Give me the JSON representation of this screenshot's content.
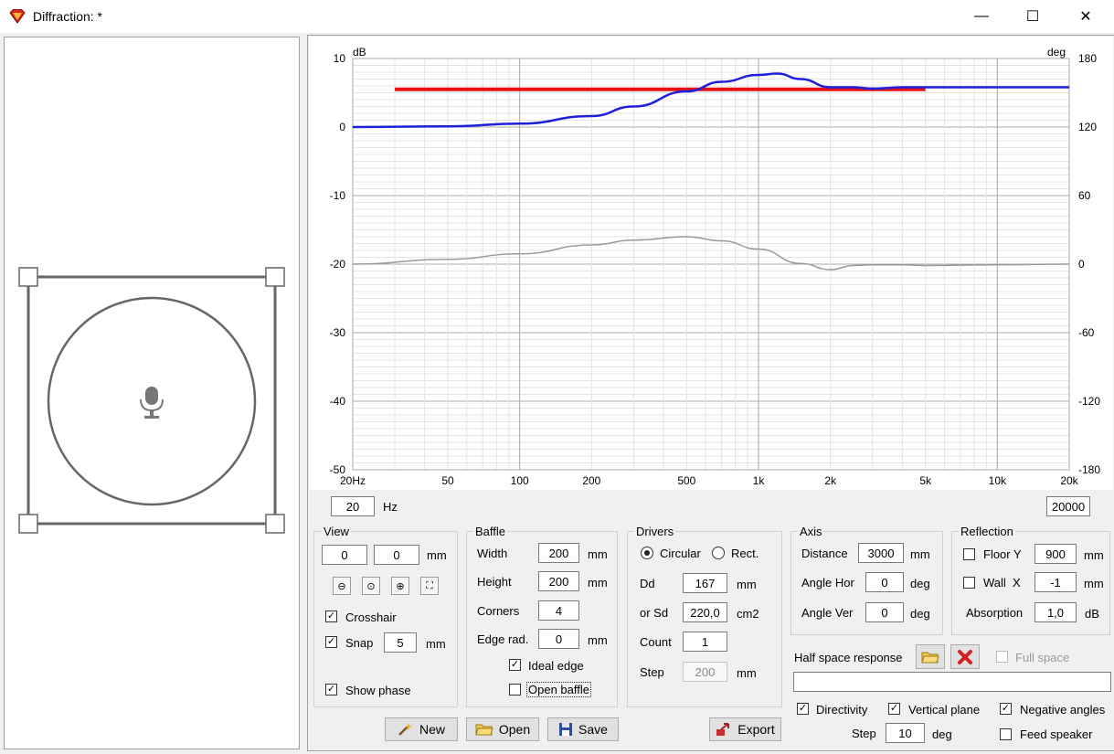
{
  "window": {
    "title": "Diffraction: *",
    "minimize": "—",
    "maximize": "☐",
    "close": "✕"
  },
  "plot": {
    "ylabel_left": "dB",
    "ylabel_right": "deg",
    "y_left_ticks": [
      "10",
      "0",
      "-10",
      "-20",
      "-30",
      "-40",
      "-50"
    ],
    "y_right_ticks": [
      "180",
      "120",
      "60",
      "0",
      "-60",
      "-120",
      "-180"
    ],
    "x_ticks": [
      "20Hz",
      "50",
      "100",
      "200",
      "500",
      "1k",
      "2k",
      "5k",
      "10k",
      "20k"
    ],
    "freq_min": "20",
    "freq_unit": "Hz",
    "freq_max": "20000"
  },
  "chart_data": {
    "type": "line",
    "x_scale": "log",
    "xlim": [
      20,
      20000
    ],
    "ylim": [
      -50,
      10
    ],
    "y2lim": [
      -180,
      180
    ],
    "xlabel": "",
    "ylabel": "dB",
    "y2label": "deg",
    "grid": true,
    "series": [
      {
        "color": "#1f1fdc",
        "axis": "left",
        "x": [
          20,
          50,
          100,
          200,
          300,
          500,
          700,
          1000,
          1200,
          1500,
          2000,
          2500,
          3000,
          4000,
          5000,
          7000,
          10000,
          20000
        ],
        "y": [
          0,
          0.1,
          0.5,
          1.6,
          3.0,
          5.2,
          6.6,
          7.6,
          7.8,
          7.0,
          5.8,
          5.8,
          5.6,
          5.8,
          5.8,
          5.8,
          5.8,
          5.8
        ]
      },
      {
        "color": "#e81010",
        "axis": "left",
        "x": [
          30,
          5000
        ],
        "y": [
          5.5,
          5.5
        ]
      },
      {
        "color": "#9a9a9a",
        "axis": "left",
        "x": [
          20,
          50,
          100,
          200,
          300,
          500,
          700,
          1000,
          1500,
          2000,
          2500,
          3000,
          4000,
          5000,
          10000,
          20000
        ],
        "y": [
          -20,
          -19.3,
          -18.5,
          -17.2,
          -16.5,
          -16,
          -16.6,
          -17.8,
          -19.9,
          -20.8,
          -20.2,
          -20.1,
          -20.1,
          -20.2,
          -20.1,
          -20
        ]
      }
    ]
  },
  "view": {
    "title": "View",
    "x": "0",
    "y": "0",
    "unit": "mm",
    "crosshair": "Crosshair",
    "snap": "Snap",
    "snap_value": "5",
    "snap_unit": "mm",
    "show_phase": "Show phase"
  },
  "baffle": {
    "title": "Baffle",
    "width_label": "Width",
    "width": "200",
    "height_label": "Height",
    "height": "200",
    "corners_label": "Corners",
    "corners": "4",
    "edge_label": "Edge rad.",
    "edge": "0",
    "unit": "mm",
    "ideal_edge": "Ideal edge",
    "open_baffle": "Open baffle"
  },
  "drivers": {
    "title": "Drivers",
    "circular": "Circular",
    "rect": "Rect.",
    "dd_label": "Dd",
    "dd": "167",
    "dd_unit": "mm",
    "sd_label": "or Sd",
    "sd": "220,0",
    "sd_unit": "cm2",
    "count_label": "Count",
    "count": "1",
    "step_label": "Step",
    "step": "200",
    "step_unit": "mm"
  },
  "axis": {
    "title": "Axis",
    "distance_label": "Distance",
    "distance": "3000",
    "distance_unit": "mm",
    "angle_hor_label": "Angle Hor",
    "angle_hor": "0",
    "angle_ver_label": "Angle Ver",
    "angle_ver": "0",
    "deg": "deg"
  },
  "reflection": {
    "title": "Reflection",
    "floor_label": "Floor Y",
    "floor": "900",
    "wall_label": "Wall  X",
    "wall": "-1",
    "unit": "mm",
    "absorption_label": "Absorption",
    "absorption": "1,0",
    "absorption_unit": "dB"
  },
  "half_space": {
    "label": "Half space response",
    "full_space": "Full space",
    "path": ""
  },
  "options": {
    "directivity": "Directivity",
    "vertical_plane": "Vertical plane",
    "negative_angles": "Negative angles",
    "step_label": "Step",
    "step": "10",
    "step_unit": "deg",
    "feed_speaker": "Feed speaker"
  },
  "buttons": {
    "new": "New",
    "open": "Open",
    "save": "Save",
    "export": "Export"
  },
  "colors": {
    "magnitude": "#1f1fdc",
    "target": "#e81010",
    "phase": "#9a9a9a",
    "delete": "#d42020"
  }
}
